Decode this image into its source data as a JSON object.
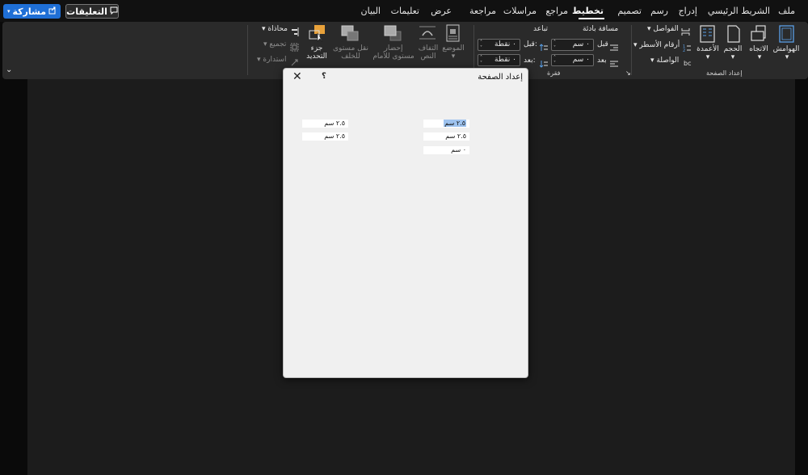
{
  "tabs": [
    {
      "label": "ملف",
      "active": false
    },
    {
      "label": "الشريط الرئيسي",
      "active": false
    },
    {
      "label": "إدراج",
      "active": false
    },
    {
      "label": "رسم",
      "active": false
    },
    {
      "label": "تصميم",
      "active": false
    },
    {
      "label": "تخطيط",
      "active": true
    },
    {
      "label": "مراجع",
      "active": false
    },
    {
      "label": "مراسلات",
      "active": false
    },
    {
      "label": "مراجعة",
      "active": false
    },
    {
      "label": "عرض",
      "active": false
    },
    {
      "label": "تعليمات",
      "active": false
    },
    {
      "label": "البيان",
      "active": false
    }
  ],
  "share_label": "مشاركة",
  "comments_label": "التعليقات",
  "ribbon": {
    "page_setup": {
      "margins": "الهوامش",
      "orientation": "الاتجاه",
      "size": "الحجم",
      "columns": "الأعمدة",
      "breaks": "الفواصل",
      "line_numbers": "أرقام الأسطر",
      "hyphenation": "الواصلة",
      "group_label": "إعداد الصفحة"
    },
    "paragraph": {
      "indent_title": "مسافة بادئة",
      "spacing_title": "تباعد",
      "before_label": "قبل",
      "after_label": "بعد",
      "spacing_before_label": "قبل:",
      "spacing_after_label": "بعد:",
      "indent_before_value": "٠ سم",
      "indent_after_value": "٠ سم",
      "spacing_before_value": "٠ نقطة",
      "spacing_after_value": "٠ نقطة",
      "group_label": "فقرة"
    },
    "arrange": {
      "position": "الموضع",
      "wrap_text": "التفاف النص",
      "bring_forward": "إحضار مستوى للأمام",
      "send_backward": "نقل مستوى للخلف",
      "selection_pane": "جزء التحديد",
      "align": "محاذاة",
      "group": "تجميع",
      "rotate": "استدارة"
    }
  },
  "dialog": {
    "title": "إعداد الصفحة",
    "help": "؟",
    "fields": {
      "top": "٢.٥ سم",
      "bottom": "٢.٥ سم",
      "gutter": "٠ سم",
      "left": "٢.٥ سم",
      "right": "٢.٥ سم"
    }
  },
  "colors": {
    "accent": "#1f6fd6",
    "ribbon_bg": "#2a2a2a",
    "dialog_bg": "#f0f0f0",
    "selection": "#9ec3ef"
  }
}
